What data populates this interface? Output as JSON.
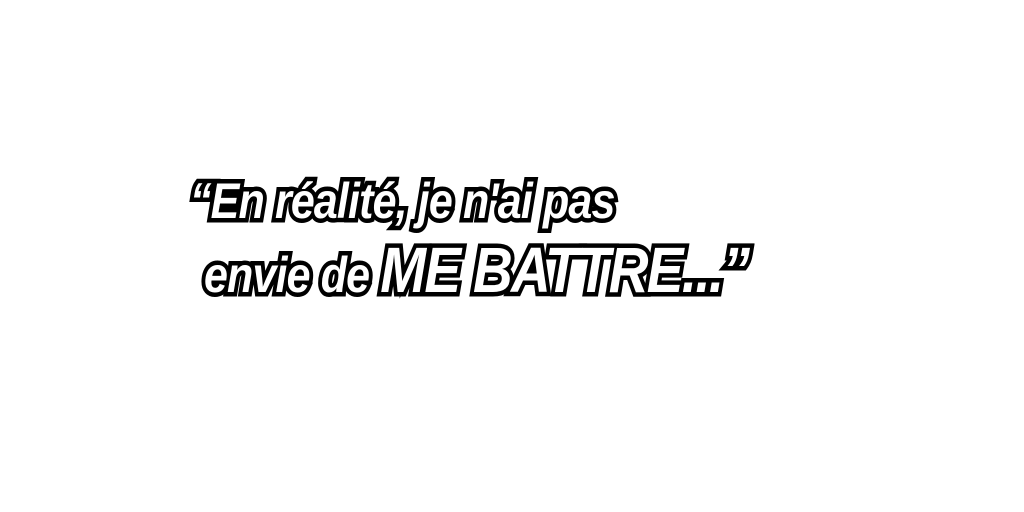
{
  "speech": {
    "line1": "“En réalité, je n'ai pas",
    "line2_start": "envie de ",
    "line2_emphasis": "ME BATTRE...”"
  },
  "colors": {
    "background": "#ffffff",
    "text_fill": "#ffffff",
    "text_outline": "#000000"
  }
}
